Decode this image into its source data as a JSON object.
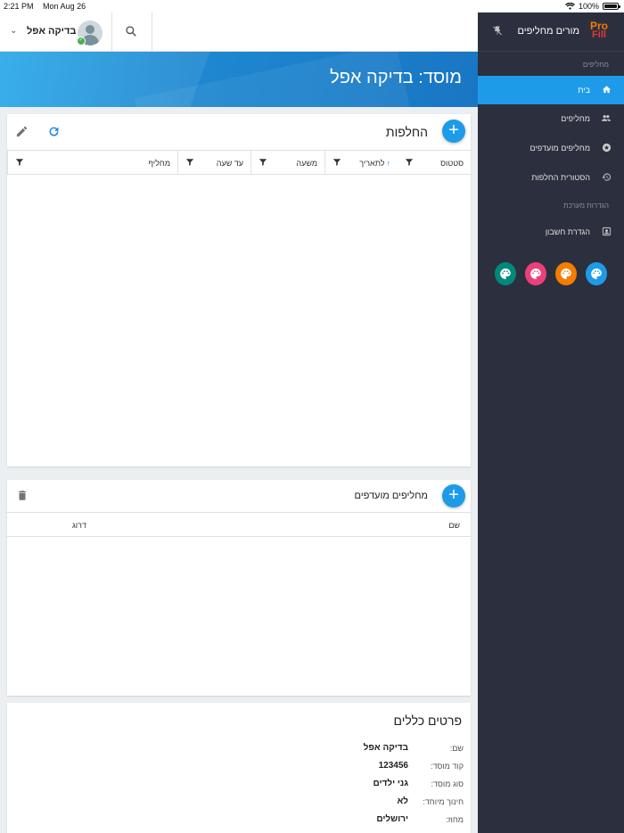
{
  "status_bar": {
    "time": "2:21 PM",
    "date": "Mon Aug 26",
    "battery": "100%"
  },
  "topbar": {
    "user_name": "בדיקה אפל"
  },
  "banner": {
    "title": "מוסד: בדיקה אפל"
  },
  "substitutions": {
    "title": "החלפות",
    "columns": [
      "סטטוס",
      "לתאריך",
      "משעה",
      "עד שעה",
      "מחליף"
    ]
  },
  "candidates": {
    "title": "מחליפים מועדפים",
    "columns": [
      "שם",
      "דרוג"
    ]
  },
  "details": {
    "title": "פרטים כללים",
    "rows": [
      {
        "label": "שם:",
        "value": "בדיקה אפל"
      },
      {
        "label": "קוד מוסד:",
        "value": "123456"
      },
      {
        "label": "סוג מוסד:",
        "value": "גני ילדים"
      },
      {
        "label": "חינוך מיוחד:",
        "value": "לא"
      },
      {
        "label": "מחוז:",
        "value": "ירושלים"
      }
    ]
  },
  "sidebar": {
    "brand": "מורים מחליפים",
    "logo_line1": "Pro",
    "logo_line2": "Fill",
    "section1": "מחליפים",
    "items": [
      {
        "label": "בית",
        "icon": "home-icon",
        "active": true
      },
      {
        "label": "מחליפים",
        "icon": "people-icon",
        "active": false
      },
      {
        "label": "מחליפים מועדפים",
        "icon": "star-icon",
        "active": false
      },
      {
        "label": "הסטורית החלפות",
        "icon": "history-icon",
        "active": false
      }
    ],
    "section2": "הגדרות מערכת",
    "account_item": {
      "label": "הגדרת חשבון",
      "icon": "account-box-icon"
    },
    "themes": [
      {
        "name": "theme-blue",
        "color": "#1e9be8"
      },
      {
        "name": "theme-orange",
        "color": "#f57c00"
      },
      {
        "name": "theme-pink",
        "color": "#ec407a"
      },
      {
        "name": "theme-teal",
        "color": "#00897b"
      }
    ]
  }
}
